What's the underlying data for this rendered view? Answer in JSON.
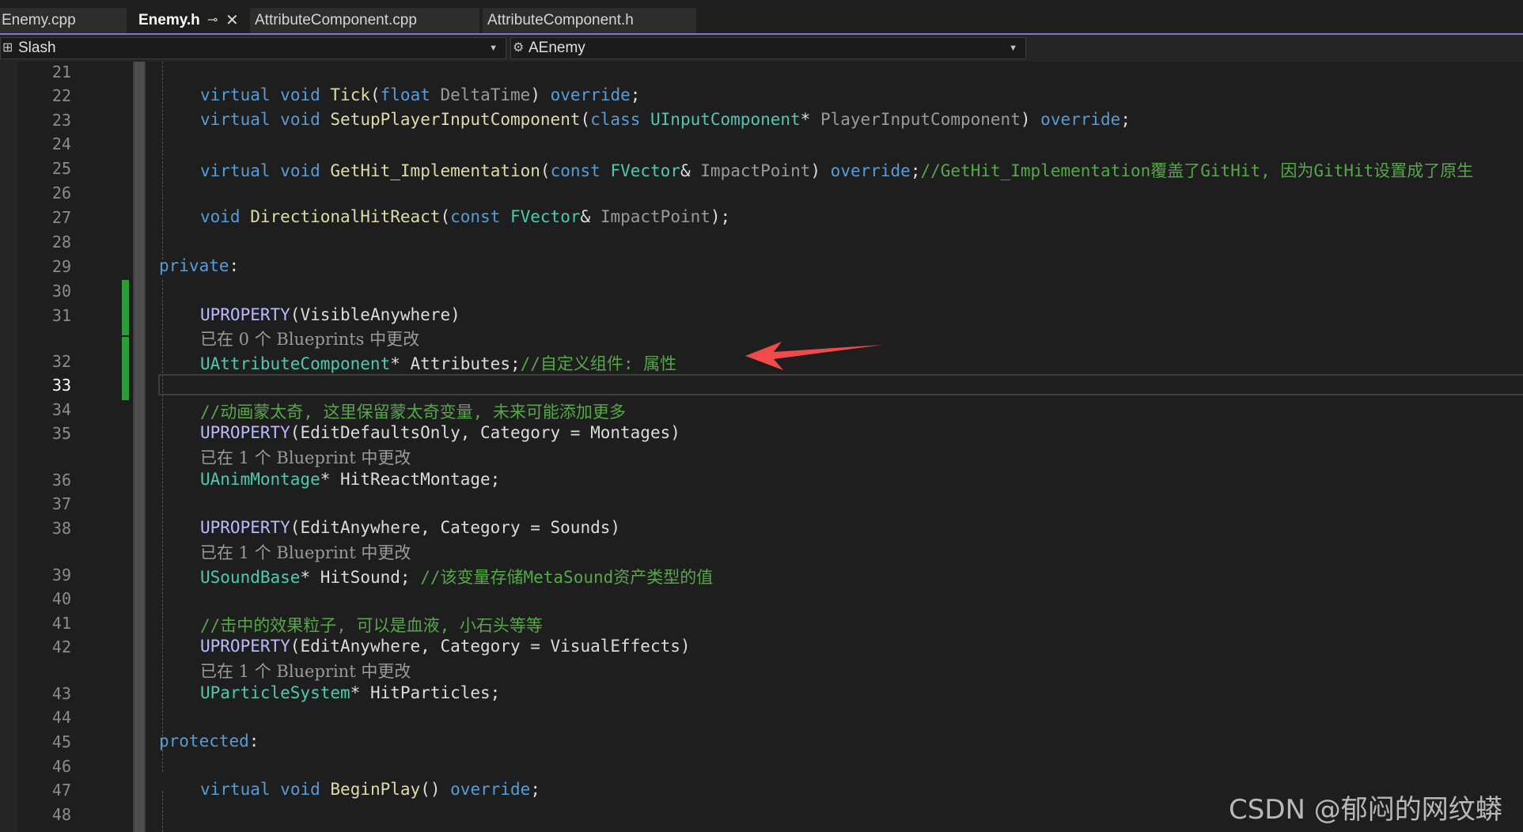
{
  "tabs": [
    {
      "label": "Enemy.cpp",
      "active": false
    },
    {
      "label": "Enemy.h",
      "active": true,
      "pin_icon": "pin-icon",
      "close_icon": "close-icon"
    },
    {
      "label": "AttributeComponent.cpp",
      "active": false
    },
    {
      "label": "AttributeComponent.h",
      "active": false
    }
  ],
  "navbar": {
    "project": "Slash",
    "scope": "AEnemy"
  },
  "editor": {
    "current_line": 33,
    "line_numbers": [
      "21",
      "22",
      "23",
      "24",
      "25",
      "26",
      "27",
      "28",
      "29",
      "30",
      "31",
      "32",
      "33",
      "34",
      "35",
      "36",
      "37",
      "38",
      "39",
      "40",
      "41",
      "42",
      "43",
      "44",
      "45",
      "46",
      "47",
      "48"
    ],
    "code": {
      "l22": {
        "a": "virtual",
        "b": "void",
        "c": "Tick",
        "d": "(",
        "e": "float",
        "f": "DeltaTime",
        "g": ")",
        "h": "override",
        "i": ";"
      },
      "l23": {
        "a": "virtual",
        "b": "void",
        "c": "SetupPlayerInputComponent",
        "d": "(",
        "e": "class",
        "f": "UInputComponent",
        "g": "*",
        "h": "PlayerInputComponent",
        "i": ")",
        "j": "override",
        "k": ";"
      },
      "l25": {
        "a": "virtual",
        "b": "void",
        "c": "GetHit_Implementation",
        "d": "(",
        "e": "const",
        "f": "FVector",
        "g": "&",
        "h": "ImpactPoint",
        "i": ")",
        "j": "override",
        "k": ";",
        "comment": "//GetHit_Implementation覆盖了GitHit, 因为GitHit设置成了原生"
      },
      "l27": {
        "a": "void",
        "b": "DirectionalHitReact",
        "c": "(",
        "d": "const",
        "e": "FVector",
        "f": "&",
        "g": "ImpactPoint",
        "h": ");"
      },
      "l29": {
        "a": "private",
        "b": ":"
      },
      "l31": {
        "a": "UPROPERTY",
        "b": "(VisibleAnywhere)"
      },
      "h31": "已在 0 个 Blueprints 中更改",
      "l32": {
        "a": "UAttributeComponent",
        "b": "*",
        "c": "Attributes;",
        "comment": "//自定义组件: 属性"
      },
      "l34": {
        "comment": "//动画蒙太奇, 这里保留蒙太奇变量, 未来可能添加更多"
      },
      "l35": {
        "a": "UPROPERTY",
        "b": "(EditDefaultsOnly, Category = Montages)"
      },
      "h35": "已在 1 个 Blueprint 中更改",
      "l36": {
        "a": "UAnimMontage",
        "b": "*",
        "c": "HitReactMontage;"
      },
      "l38": {
        "a": "UPROPERTY",
        "b": "(EditAnywhere, Category = Sounds)"
      },
      "h38": "已在 1 个 Blueprint 中更改",
      "l39": {
        "a": "USoundBase",
        "b": "*",
        "c": "HitSound;",
        "comment": "//该变量存储MetaSound资产类型的值"
      },
      "l41": {
        "comment": "//击中的效果粒子, 可以是血液, 小石头等等"
      },
      "l42": {
        "a": "UPROPERTY",
        "b": "(EditAnywhere, Category = VisualEffects)"
      },
      "h42": "已在 1 个 Blueprint 中更改",
      "l43": {
        "a": "UParticleSystem",
        "b": "*",
        "c": "HitParticles;"
      },
      "l45": {
        "a": "protected",
        "b": ":"
      },
      "l47": {
        "a": "virtual",
        "b": "void",
        "c": "BeginPlay",
        "d": "()",
        "e": "override",
        "f": ";"
      }
    }
  },
  "annotation": {
    "arrow_color": "#f04a4a"
  },
  "watermark": "CSDN @郁闷的网纹蟒",
  "colors": {
    "keyword": "#569cd6",
    "type": "#4ec9b0",
    "function": "#dcdcaa",
    "macro": "#beb7ff",
    "comment": "#57a64a",
    "accent": "#8a6fd6"
  }
}
